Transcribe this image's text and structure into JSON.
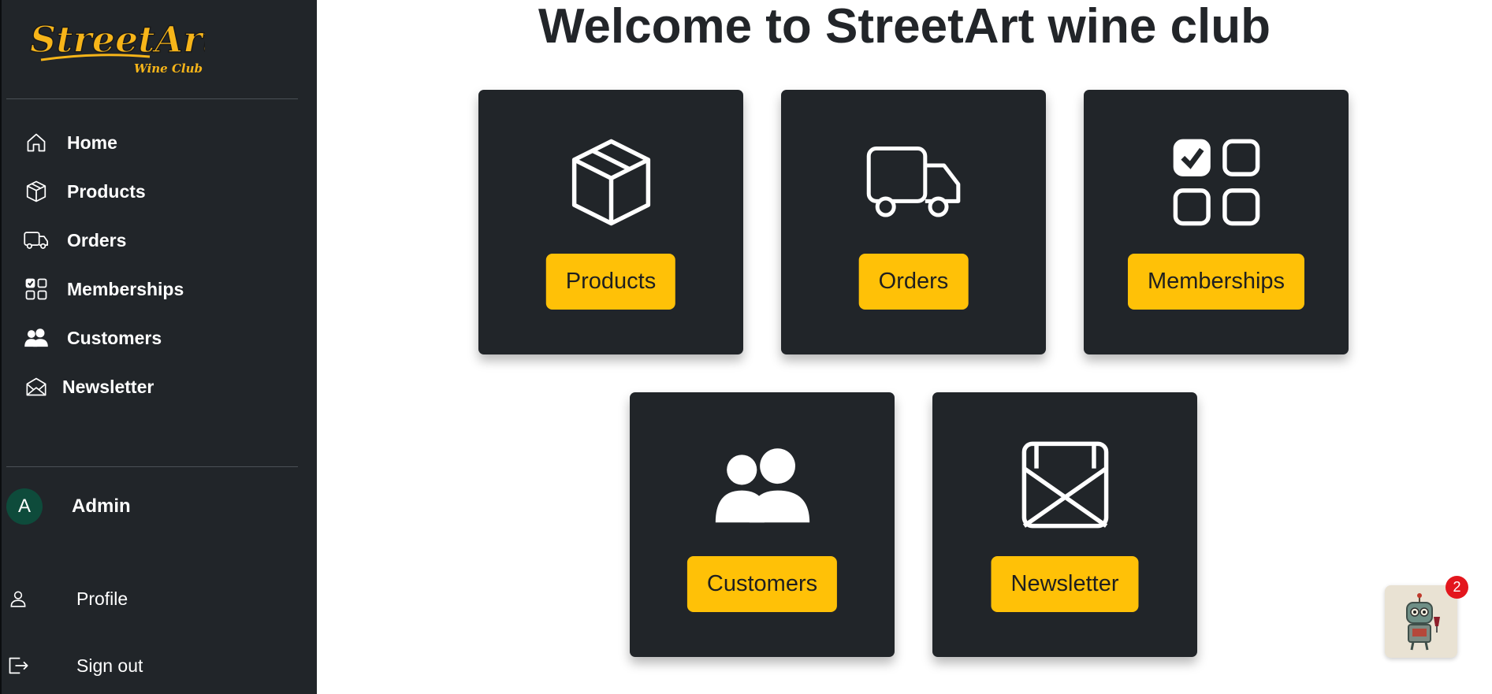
{
  "brand": {
    "logo_text": "StreetArt",
    "logo_subtext": "Wine Club"
  },
  "sidebar": {
    "items": [
      {
        "label": "Home",
        "icon": "home-icon"
      },
      {
        "label": "Products",
        "icon": "box-icon"
      },
      {
        "label": "Orders",
        "icon": "truck-icon"
      },
      {
        "label": "Memberships",
        "icon": "checklist-grid-icon"
      },
      {
        "label": "Customers",
        "icon": "people-icon"
      },
      {
        "label": "Newsletter",
        "icon": "envelope-open-icon"
      }
    ],
    "user": {
      "avatar_letter": "A",
      "name": "Admin"
    },
    "account": [
      {
        "label": "Profile",
        "icon": "person-icon"
      },
      {
        "label": "Sign out",
        "icon": "sign-out-icon"
      }
    ]
  },
  "main": {
    "title": "Welcome to StreetArt wine club",
    "cards": [
      {
        "label": "Products",
        "icon": "box-icon"
      },
      {
        "label": "Orders",
        "icon": "truck-icon"
      },
      {
        "label": "Memberships",
        "icon": "checklist-grid-icon"
      },
      {
        "label": "Customers",
        "icon": "people-icon"
      },
      {
        "label": "Newsletter",
        "icon": "envelope-open-icon"
      }
    ]
  },
  "chat_widget": {
    "badge_count": "2",
    "icon": "robot-mascot-icon"
  },
  "colors": {
    "sidebar_bg": "#212529",
    "accent": "#ffc107",
    "title": "#222529",
    "badge": "#e3161d",
    "avatar": "#0e4b3b"
  }
}
